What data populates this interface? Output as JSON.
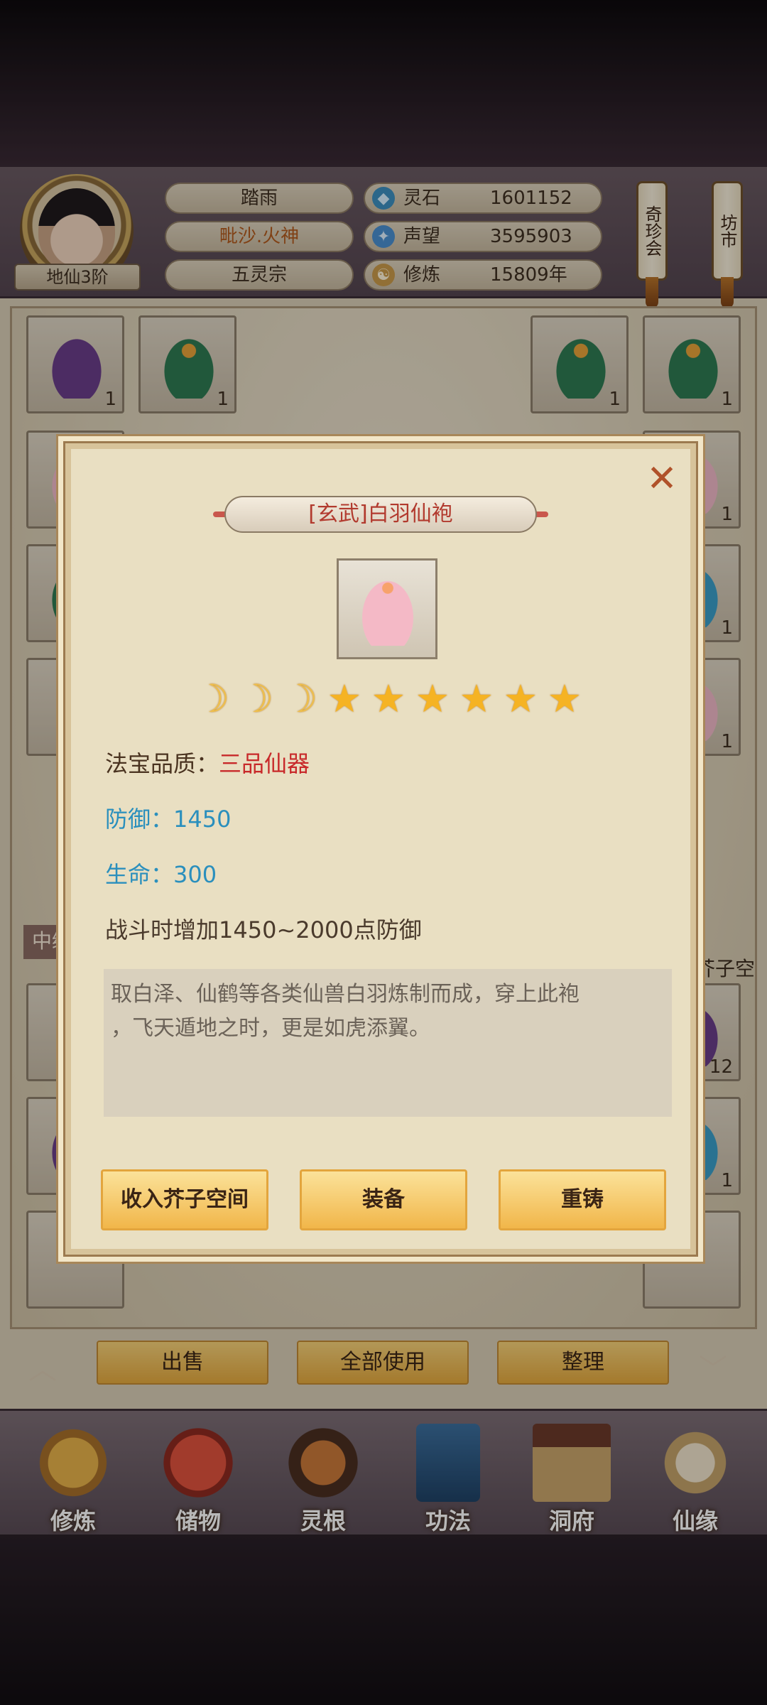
{
  "player": {
    "rank": "地仙3阶",
    "name": "踏雨",
    "title": "毗沙.火神",
    "sect": "五灵宗"
  },
  "resources": [
    {
      "icon": "spirit-stone-icon",
      "label": "灵石",
      "value": "1601152"
    },
    {
      "icon": "reputation-icon",
      "label": "声望",
      "value": "3595903"
    },
    {
      "icon": "cultivation-icon",
      "label": "修炼",
      "value": "15809年"
    }
  ],
  "side_buttons": {
    "treasure_fair": "奇珍会",
    "market": "坊市"
  },
  "inventory": {
    "counts": {
      "top_row": [
        "1",
        "1",
        "1",
        "1"
      ],
      "right_column": [
        "1",
        "1",
        "1",
        "12",
        "1"
      ]
    },
    "tier_tag": "中级",
    "space_label": "芥子空间"
  },
  "action_bar": {
    "sell": "出售",
    "use_all": "全部使用",
    "sort": "整理"
  },
  "nav": [
    {
      "label": "修炼",
      "icon": "meditation-icon"
    },
    {
      "label": "储物",
      "icon": "storage-bag-icon"
    },
    {
      "label": "灵根",
      "icon": "spirit-root-icon"
    },
    {
      "label": "功法",
      "icon": "technique-book-icon"
    },
    {
      "label": "洞府",
      "icon": "cave-mansion-icon"
    },
    {
      "label": "仙缘",
      "icon": "destiny-icon"
    }
  ],
  "modal": {
    "title": "[玄武]白羽仙袍",
    "rating": {
      "moons": 3,
      "stars": 6
    },
    "quality_label": "法宝品质：",
    "quality_value": "三品仙器",
    "defense": "防御：1450",
    "life": "生命：300",
    "effect": "战斗时增加1450~2000点防御",
    "description_line1": "取白泽、仙鹤等各类仙兽白羽炼制而成，穿上此袍",
    "description_line2": "，飞天遁地之时，更是如虎添翼。",
    "buttons": {
      "store": "收入芥子空间",
      "equip": "装备",
      "reforge": "重铸"
    }
  },
  "colors": {
    "title_red": "#b23a2e",
    "quality_red": "#c8292a",
    "stat_blue": "#2a8fbd",
    "button_gold": "#f1b64a"
  }
}
